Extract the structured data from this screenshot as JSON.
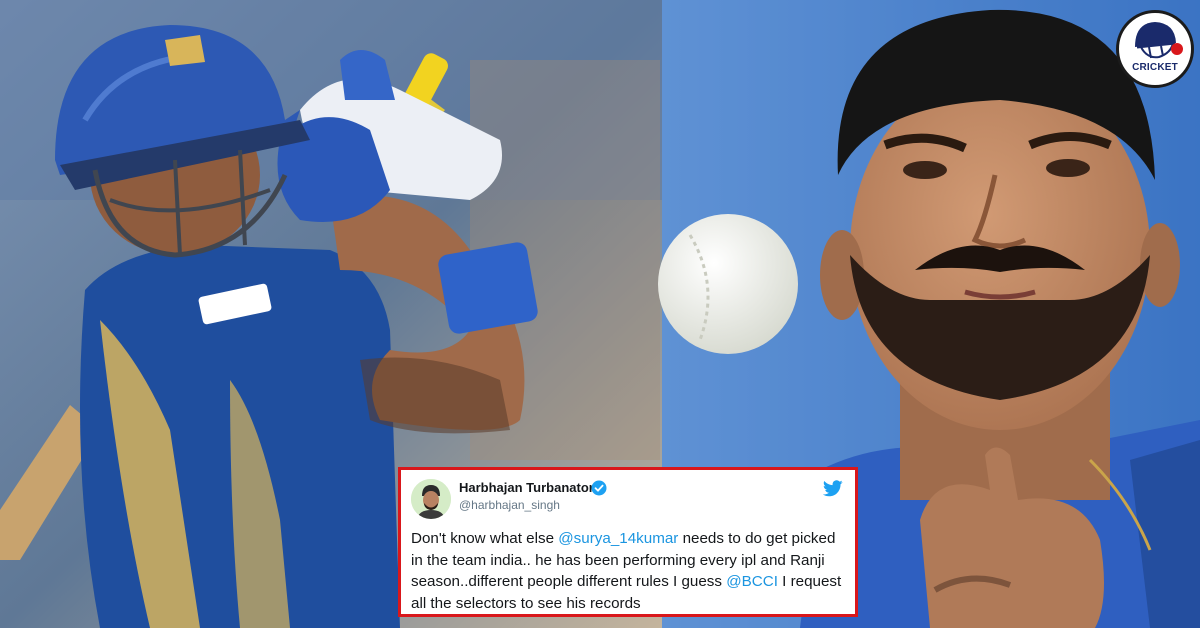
{
  "tweet": {
    "display_name": "Harbhajan Turbanator",
    "handle": "@harbhajan_singh",
    "text_1": "Don't know what else ",
    "mention_1": "@surya_14kumar",
    "text_2": " needs to do get picked in the team india.. he has been performing every ipl and Ranji season..different people different rules I guess ",
    "mention_2": "@BCCI",
    "text_3": " I request all the selectors to see his records"
  },
  "logo": {
    "wordmark": "CRICKET"
  },
  "icons": [
    "verified-badge-icon",
    "twitter-bird-icon",
    "cricket-helmet-icon"
  ],
  "colors": {
    "tweet_border": "#d9171b",
    "mention": "#1b95e0",
    "verified": "#1da1f2",
    "jersey_blue": "#1f4e9e",
    "jersey_gold": "#d8b55a"
  }
}
